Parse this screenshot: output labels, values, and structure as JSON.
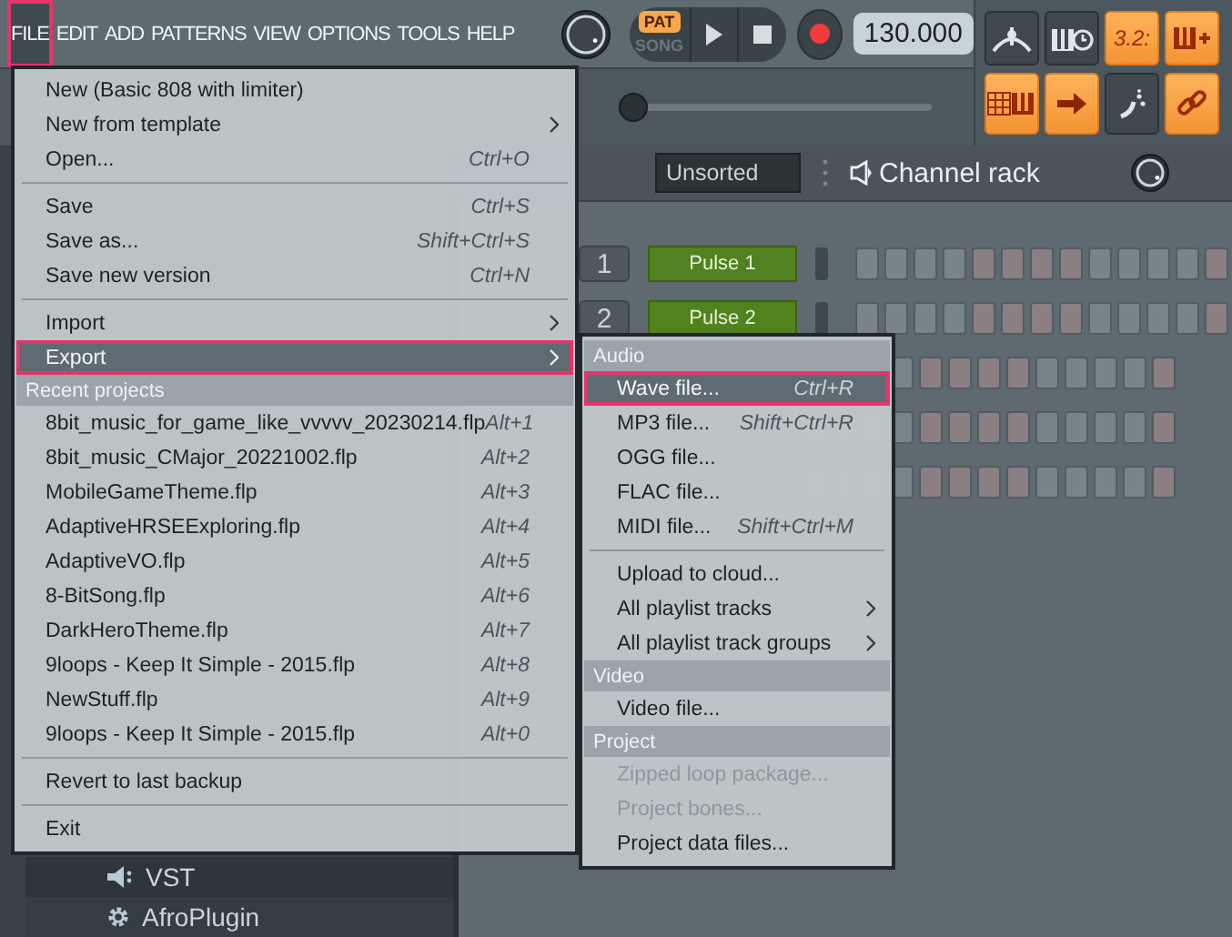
{
  "menubar": [
    {
      "label": "FILE",
      "selected": true,
      "annotated": true
    },
    {
      "label": "EDIT",
      "selected": false,
      "annotated": false
    },
    {
      "label": "ADD",
      "selected": false,
      "annotated": false
    },
    {
      "label": "PATTERNS",
      "selected": false,
      "annotated": false
    },
    {
      "label": "VIEW",
      "selected": false,
      "annotated": false
    },
    {
      "label": "OPTIONS",
      "selected": false,
      "annotated": false
    },
    {
      "label": "TOOLS",
      "selected": false,
      "annotated": false
    },
    {
      "label": "HELP",
      "selected": false,
      "annotated": false
    }
  ],
  "transport": {
    "modes": [
      {
        "label": "PAT",
        "selected": true
      },
      {
        "label": "SONG",
        "selected": false
      }
    ],
    "tempo": "130.000"
  },
  "toolbar": [
    {
      "kind": "metronome",
      "on": false
    },
    {
      "kind": "keys-clock",
      "on": false
    },
    {
      "kind": "counter",
      "label": "3.2:",
      "on": true
    },
    {
      "kind": "keys-plus",
      "on": true
    },
    {
      "kind": "grid-keys",
      "on": true
    },
    {
      "kind": "arrow",
      "on": true
    },
    {
      "kind": "squiggle",
      "on": false
    },
    {
      "kind": "link",
      "on": true
    }
  ],
  "channel_rack": {
    "filter": "Unsorted",
    "title": "Channel rack",
    "channels": [
      {
        "number": "1",
        "name": "Pulse 1"
      },
      {
        "number": "2",
        "name": "Pulse 2"
      }
    ]
  },
  "browser": {
    "items": [
      {
        "kind": "folder",
        "label": "VST"
      },
      {
        "kind": "plugin",
        "label": "AfroPlugin"
      }
    ]
  },
  "file_menu": {
    "items": [
      {
        "kind": "item",
        "label": "New (Basic 808 with limiter)",
        "submenu": false,
        "highlighted": false,
        "disabled": false,
        "annotated": false
      },
      {
        "kind": "item",
        "label": "New from template",
        "submenu": true,
        "highlighted": false,
        "disabled": false,
        "annotated": false
      },
      {
        "kind": "item",
        "label": "Open...",
        "shortcut": "Ctrl+O",
        "submenu": false,
        "highlighted": false,
        "disabled": false,
        "annotated": false
      },
      {
        "kind": "separator"
      },
      {
        "kind": "item",
        "label": "Save",
        "shortcut": "Ctrl+S",
        "submenu": false,
        "highlighted": false,
        "disabled": false,
        "annotated": false
      },
      {
        "kind": "item",
        "label": "Save as...",
        "shortcut": "Shift+Ctrl+S",
        "submenu": false,
        "highlighted": false,
        "disabled": false,
        "annotated": false
      },
      {
        "kind": "item",
        "label": "Save new version",
        "shortcut": "Ctrl+N",
        "submenu": false,
        "highlighted": false,
        "disabled": false,
        "annotated": false
      },
      {
        "kind": "separator"
      },
      {
        "kind": "item",
        "label": "Import",
        "submenu": true,
        "highlighted": false,
        "disabled": false,
        "annotated": false
      },
      {
        "kind": "item",
        "label": "Export",
        "submenu": true,
        "highlighted": true,
        "disabled": false,
        "annotated": true
      },
      {
        "kind": "header",
        "label": "Recent projects"
      },
      {
        "kind": "item",
        "label": "8bit_music_for_game_like_vvvvv_20230214.flp",
        "shortcut": "Alt+1",
        "submenu": false,
        "highlighted": false,
        "disabled": false,
        "annotated": false
      },
      {
        "kind": "item",
        "label": "8bit_music_CMajor_20221002.flp",
        "shortcut": "Alt+2",
        "submenu": false,
        "highlighted": false,
        "disabled": false,
        "annotated": false
      },
      {
        "kind": "item",
        "label": "MobileGameTheme.flp",
        "shortcut": "Alt+3",
        "submenu": false,
        "highlighted": false,
        "disabled": false,
        "annotated": false
      },
      {
        "kind": "item",
        "label": "AdaptiveHRSEExploring.flp",
        "shortcut": "Alt+4",
        "submenu": false,
        "highlighted": false,
        "disabled": false,
        "annotated": false
      },
      {
        "kind": "item",
        "label": "AdaptiveVO.flp",
        "shortcut": "Alt+5",
        "submenu": false,
        "highlighted": false,
        "disabled": false,
        "annotated": false
      },
      {
        "kind": "item",
        "label": "8-BitSong.flp",
        "shortcut": "Alt+6",
        "submenu": false,
        "highlighted": false,
        "disabled": false,
        "annotated": false
      },
      {
        "kind": "item",
        "label": "DarkHeroTheme.flp",
        "shortcut": "Alt+7",
        "submenu": false,
        "highlighted": false,
        "disabled": false,
        "annotated": false
      },
      {
        "kind": "item",
        "label": "9loops - Keep It Simple - 2015.flp",
        "shortcut": "Alt+8",
        "submenu": false,
        "highlighted": false,
        "disabled": false,
        "annotated": false
      },
      {
        "kind": "item",
        "label": "NewStuff.flp",
        "shortcut": "Alt+9",
        "submenu": false,
        "highlighted": false,
        "disabled": false,
        "annotated": false
      },
      {
        "kind": "item",
        "label": "9loops - Keep It Simple - 2015.flp",
        "shortcut": "Alt+0",
        "submenu": false,
        "highlighted": false,
        "disabled": false,
        "annotated": false
      },
      {
        "kind": "separator"
      },
      {
        "kind": "item",
        "label": "Revert to last backup",
        "submenu": false,
        "highlighted": false,
        "disabled": false,
        "annotated": false
      },
      {
        "kind": "separator"
      },
      {
        "kind": "item",
        "label": "Exit",
        "submenu": false,
        "highlighted": false,
        "disabled": false,
        "annotated": false
      }
    ]
  },
  "export_menu": {
    "items": [
      {
        "kind": "header",
        "label": "Audio"
      },
      {
        "kind": "item",
        "label": "Wave file...",
        "shortcut": "Ctrl+R",
        "submenu": false,
        "highlighted": true,
        "disabled": false,
        "annotated": true
      },
      {
        "kind": "item",
        "label": "MP3 file...",
        "shortcut": "Shift+Ctrl+R",
        "submenu": false,
        "highlighted": false,
        "disabled": false,
        "annotated": false
      },
      {
        "kind": "item",
        "label": "OGG file...",
        "submenu": false,
        "highlighted": false,
        "disabled": false,
        "annotated": false
      },
      {
        "kind": "item",
        "label": "FLAC file...",
        "submenu": false,
        "highlighted": false,
        "disabled": false,
        "annotated": false
      },
      {
        "kind": "item",
        "label": "MIDI file...",
        "shortcut": "Shift+Ctrl+M",
        "submenu": false,
        "highlighted": false,
        "disabled": false,
        "annotated": false
      },
      {
        "kind": "separator"
      },
      {
        "kind": "item",
        "label": "Upload to cloud...",
        "submenu": false,
        "highlighted": false,
        "disabled": false,
        "annotated": false
      },
      {
        "kind": "item",
        "label": "All playlist tracks",
        "submenu": true,
        "highlighted": false,
        "disabled": false,
        "annotated": false
      },
      {
        "kind": "item",
        "label": "All playlist track groups",
        "submenu": true,
        "highlighted": false,
        "disabled": false,
        "annotated": false
      },
      {
        "kind": "header",
        "label": "Video"
      },
      {
        "kind": "item",
        "label": "Video file...",
        "submenu": false,
        "highlighted": false,
        "disabled": false,
        "annotated": false
      },
      {
        "kind": "header",
        "label": "Project"
      },
      {
        "kind": "item",
        "label": "Zipped loop package...",
        "submenu": false,
        "highlighted": false,
        "disabled": true,
        "annotated": false
      },
      {
        "kind": "item",
        "label": "Project bones...",
        "submenu": false,
        "highlighted": false,
        "disabled": true,
        "annotated": false
      },
      {
        "kind": "item",
        "label": "Project data files...",
        "submenu": false,
        "highlighted": false,
        "disabled": false,
        "annotated": false
      }
    ]
  }
}
